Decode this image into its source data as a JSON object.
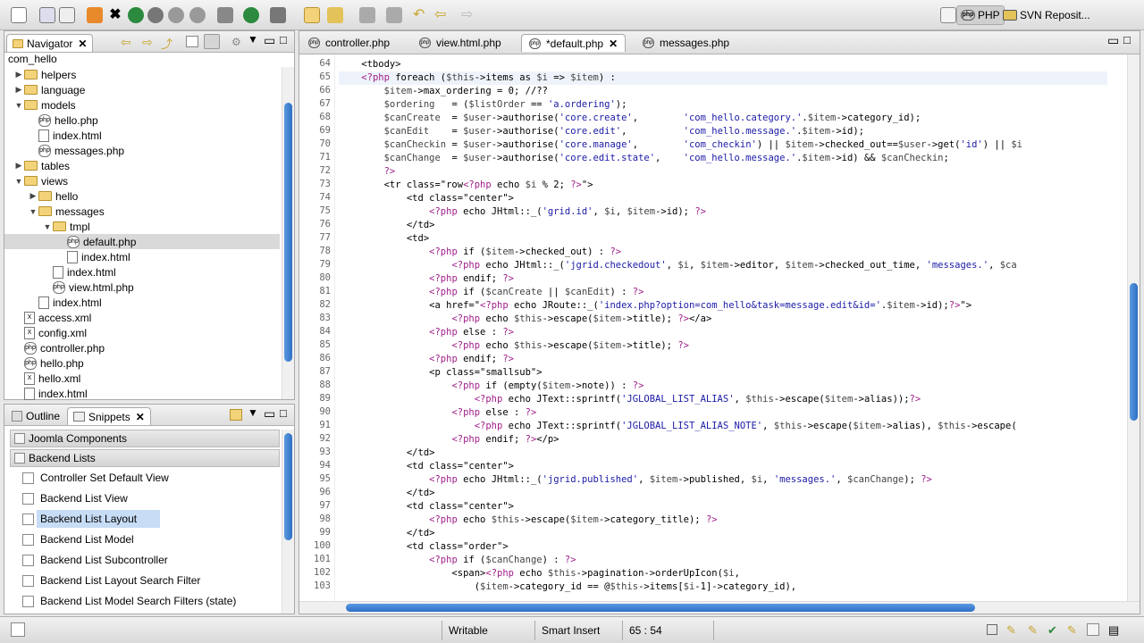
{
  "perspectives": {
    "php": "PHP",
    "svn": "SVN Reposit..."
  },
  "navigator": {
    "tab_label": "Navigator",
    "project": "com_hello",
    "items": [
      {
        "label": "helpers",
        "kind": "folder",
        "depth": 1,
        "expanded": false
      },
      {
        "label": "language",
        "kind": "folder",
        "depth": 1,
        "expanded": false
      },
      {
        "label": "models",
        "kind": "folder",
        "depth": 1,
        "expanded": true
      },
      {
        "label": "hello.php",
        "kind": "php",
        "depth": 2
      },
      {
        "label": "index.html",
        "kind": "file",
        "depth": 2
      },
      {
        "label": "messages.php",
        "kind": "php",
        "depth": 2
      },
      {
        "label": "tables",
        "kind": "folder",
        "depth": 1,
        "expanded": false
      },
      {
        "label": "views",
        "kind": "folder",
        "depth": 1,
        "expanded": true
      },
      {
        "label": "hello",
        "kind": "folder",
        "depth": 2,
        "expanded": false
      },
      {
        "label": "messages",
        "kind": "folder",
        "depth": 2,
        "expanded": true
      },
      {
        "label": "tmpl",
        "kind": "folder",
        "depth": 3,
        "expanded": true
      },
      {
        "label": "default.php",
        "kind": "php",
        "depth": 4,
        "selected": true
      },
      {
        "label": "index.html",
        "kind": "file",
        "depth": 4
      },
      {
        "label": "index.html",
        "kind": "file",
        "depth": 3
      },
      {
        "label": "view.html.php",
        "kind": "php",
        "depth": 3
      },
      {
        "label": "index.html",
        "kind": "file",
        "depth": 2
      },
      {
        "label": "access.xml",
        "kind": "xml",
        "depth": 1
      },
      {
        "label": "config.xml",
        "kind": "xml",
        "depth": 1
      },
      {
        "label": "controller.php",
        "kind": "php",
        "depth": 1
      },
      {
        "label": "hello.php",
        "kind": "php",
        "depth": 1
      },
      {
        "label": "hello.xml",
        "kind": "xml",
        "depth": 1
      },
      {
        "label": "index.html",
        "kind": "file",
        "depth": 1
      }
    ]
  },
  "bottom_panel": {
    "tabs": [
      "Outline",
      "Snippets"
    ],
    "groups": [
      "Joomla Components",
      "Backend Lists"
    ],
    "items": [
      "Controller Set Default View",
      "Backend List View",
      "Backend List Layout",
      "Backend List Model",
      "Backend List Subcontroller",
      "Backend List Layout Search Filter",
      "Backend List Model Search Filters (state)"
    ],
    "highlighted_item": "Backend List Layout"
  },
  "editor": {
    "tabs": [
      "controller.php",
      "view.html.php",
      "*default.php",
      "messages.php"
    ],
    "active_tab": "*default.php",
    "line_numbers": [
      64,
      65,
      66,
      67,
      68,
      69,
      70,
      71,
      72,
      73,
      74,
      75,
      76,
      77,
      78,
      79,
      80,
      81,
      82,
      83,
      84,
      85,
      86,
      87,
      88,
      89,
      90,
      91,
      92,
      93,
      94,
      95,
      96,
      97,
      98,
      99,
      100,
      101,
      102,
      103
    ],
    "lines": [
      "    <tbody>",
      "    <?php foreach ($this->items as $i => $item) :",
      "        $item->max_ordering = 0; //??",
      "        $ordering   = ($listOrder == 'a.ordering');",
      "        $canCreate  = $user->authorise('core.create',        'com_hello.category.'.$item->category_id);",
      "        $canEdit    = $user->authorise('core.edit',          'com_hello.message.'.$item->id);",
      "        $canCheckin = $user->authorise('core.manage',        'com_checkin') || $item->checked_out==$user->get('id') || $i",
      "        $canChange  = $user->authorise('core.edit.state',    'com_hello.message.'.$item->id) && $canCheckin;",
      "        ?>",
      "        <tr class=\"row<?php echo $i % 2; ?>\">",
      "            <td class=\"center\">",
      "                <?php echo JHtml::_('grid.id', $i, $item->id); ?>",
      "            </td>",
      "            <td>",
      "                <?php if ($item->checked_out) : ?>",
      "                    <?php echo JHtml::_('jgrid.checkedout', $i, $item->editor, $item->checked_out_time, 'messages.', $ca",
      "                <?php endif; ?>",
      "                <?php if ($canCreate || $canEdit) : ?>",
      "                <a href=\"<?php echo JRoute::_('index.php?option=com_hello&task=message.edit&id='.$item->id);?>\">",
      "                    <?php echo $this->escape($item->title); ?></a>",
      "                <?php else : ?>",
      "                    <?php echo $this->escape($item->title); ?>",
      "                <?php endif; ?>",
      "                <p class=\"smallsub\">",
      "                    <?php if (empty($item->note)) : ?>",
      "                        <?php echo JText::sprintf('JGLOBAL_LIST_ALIAS', $this->escape($item->alias));?>",
      "                    <?php else : ?>",
      "                        <?php echo JText::sprintf('JGLOBAL_LIST_ALIAS_NOTE', $this->escape($item->alias), $this->escape(",
      "                    <?php endif; ?></p>",
      "            </td>",
      "            <td class=\"center\">",
      "                <?php echo JHtml::_('jgrid.published', $item->published, $i, 'messages.', $canChange); ?>",
      "            </td>",
      "            <td class=\"center\">",
      "                <?php echo $this->escape($item->category_title); ?>",
      "            </td>",
      "            <td class=\"order\">",
      "                <?php if ($canChange) : ?>",
      "                    <span><?php echo $this->pagination->orderUpIcon($i,",
      "                        ($item->category_id == @$this->items[$i-1]->category_id),"
    ]
  },
  "status_bar": {
    "mode": "Writable",
    "insert": "Smart Insert",
    "position": "65 : 54"
  },
  "colors": {
    "accent": "#2f6fc5",
    "selection": "#c7dcf5",
    "current_line": "#eef3fb"
  }
}
